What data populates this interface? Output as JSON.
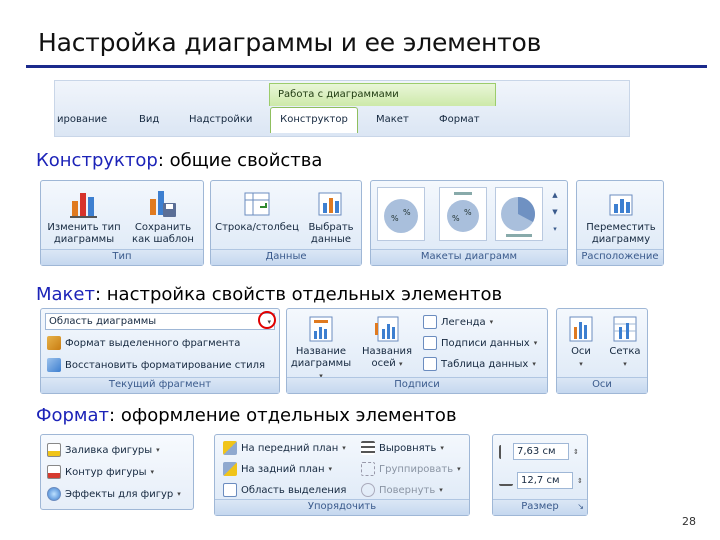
{
  "title": "Настройка диаграммы и ее элементов",
  "page_number": "28",
  "tabs_bar": {
    "context_title": "Работа с диаграммами",
    "tabs": [
      "ирование",
      "Вид",
      "Надстройки",
      "Конструктор",
      "Макет",
      "Формат"
    ]
  },
  "sections": {
    "designer": {
      "accent": "Конструктор",
      "rest": ": общие свойства"
    },
    "layout": {
      "accent": "Макет",
      "rest": ": настройка свойств отдельных элементов"
    },
    "format": {
      "accent": "Формат",
      "rest": ": оформление отдельных элементов"
    }
  },
  "designer_ribbon": {
    "type_group": {
      "caption": "Тип",
      "change_type_l1": "Изменить тип",
      "change_type_l2": "диаграммы",
      "save_tpl_l1": "Сохранить",
      "save_tpl_l2": "как шаблон"
    },
    "data_group": {
      "caption": "Данные",
      "row_col": "Строка/столбец",
      "select_l1": "Выбрать",
      "select_l2": "данные"
    },
    "layouts_group": {
      "caption": "Макеты диаграмм",
      "mini1": "%",
      "mini2": "%"
    },
    "location_group": {
      "caption": "Расположение",
      "move_l1": "Переместить",
      "move_l2": "диаграмму"
    }
  },
  "layout_ribbon": {
    "current_group": {
      "caption": "Текущий фрагмент",
      "combo": "Область диаграммы",
      "format_sel": "Формат выделенного фрагмента",
      "reset": "Восстановить форматирование стиля"
    },
    "labels_group": {
      "caption": "Подписи",
      "chart_title_l1": "Название",
      "chart_title_l2": "диаграммы",
      "axes_title_l1": "Названия",
      "axes_title_l2": "осей",
      "legend": "Легенда",
      "data_labels": "Подписи данных",
      "data_table": "Таблица данных"
    },
    "axes_group": {
      "caption": "Оси",
      "axes": "Оси",
      "grid": "Сетка"
    }
  },
  "format_ribbon": {
    "shape_group": {
      "fill": "Заливка фигуры",
      "outline": "Контур фигуры",
      "effects": "Эффекты для фигур"
    },
    "arrange_group": {
      "caption": "Упорядочить",
      "front": "На передний план",
      "back": "На задний план",
      "selection": "Область выделения",
      "align": "Выровнять",
      "group": "Группировать",
      "rotate": "Повернуть"
    },
    "size_group": {
      "caption": "Размер",
      "height": "7,63 см",
      "width": "12,7 см"
    }
  },
  "colors": {
    "accent": "#1c23b8",
    "rule": "#1b2a8c",
    "highlight": "#e00000"
  }
}
